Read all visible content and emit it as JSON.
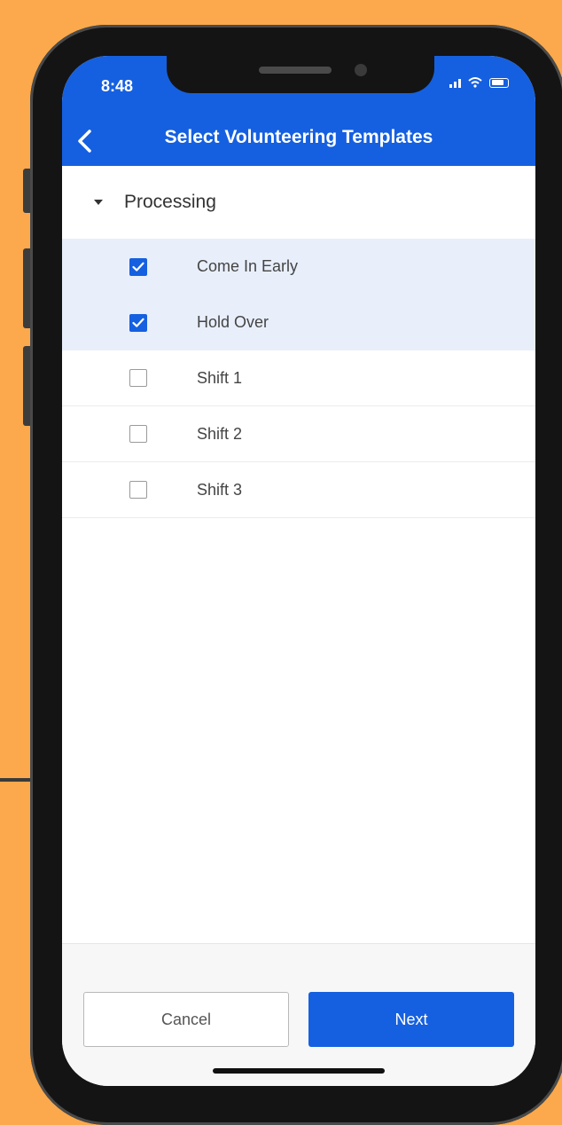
{
  "status_bar": {
    "time": "8:48"
  },
  "header": {
    "title": "Select Volunteering Templates",
    "back_icon": "chevron-left-icon"
  },
  "group": {
    "label": "Processing",
    "expanded": true
  },
  "templates": [
    {
      "label": "Come In Early",
      "checked": true
    },
    {
      "label": "Hold Over",
      "checked": true
    },
    {
      "label": "Shift 1",
      "checked": false
    },
    {
      "label": "Shift 2",
      "checked": false
    },
    {
      "label": "Shift 3",
      "checked": false
    }
  ],
  "footer": {
    "cancel_label": "Cancel",
    "next_label": "Next"
  },
  "colors": {
    "accent": "#1560E0",
    "selected_row": "#E8EFFA",
    "background": "#FBA94C"
  }
}
